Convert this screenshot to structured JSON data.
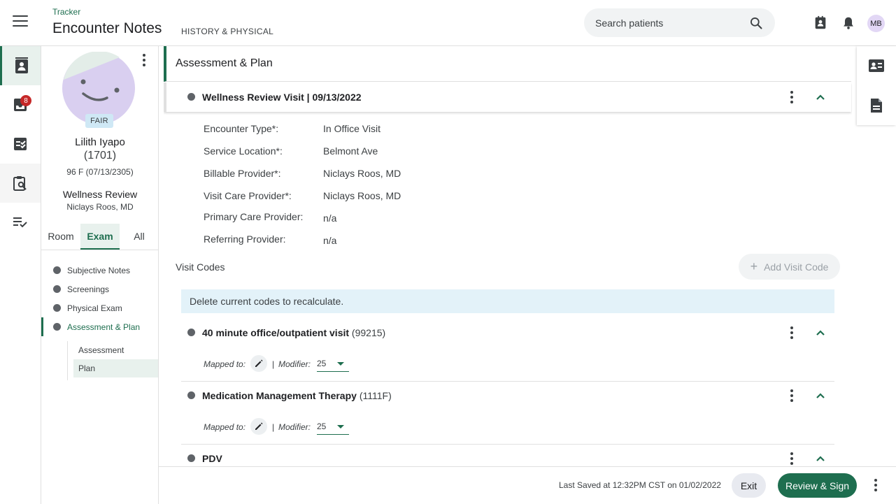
{
  "header": {
    "breadcrumb": "Tracker",
    "title": "Encounter Notes",
    "subtitle": "HISTORY & PHYSICAL",
    "search_placeholder": "Search patients",
    "user_initials": "MB"
  },
  "rail": {
    "items": [
      "patients-icon",
      "inbox-icon",
      "tasks-icon",
      "clipboard-search-icon",
      "checklist-icon"
    ],
    "inbox_badge": "8"
  },
  "patient": {
    "status": "FAIR",
    "name": "Lilith Iyapo",
    "id": "(1701)",
    "demographics": "96 F (07/13/2305)",
    "visit_type": "Wellness Review",
    "provider": "Niclays Roos, MD",
    "tabs": [
      "Room",
      "Exam",
      "All"
    ],
    "active_tab": "Exam",
    "sections": [
      "Subjective Notes",
      "Screenings",
      "Physical Exam",
      "Assessment & Plan"
    ],
    "subsections": [
      "Assessment",
      "Plan"
    ]
  },
  "main": {
    "section_title": "Assessment & Plan",
    "visit_title": "Wellness Review Visit | 09/13/2022",
    "details": [
      {
        "label": "Encounter Type*:",
        "value": "In Office Visit"
      },
      {
        "label": "Service Location*:",
        "value": "Belmont Ave"
      },
      {
        "label": "Billable Provider*:",
        "value": "Niclays Roos, MD"
      },
      {
        "label": "Visit Care Provider*:",
        "value": "Niclays Roos, MD"
      },
      {
        "label": "Primary Care Provider:",
        "value": "n/a"
      },
      {
        "label": "Referring Provider:",
        "value": "n/a"
      }
    ],
    "visit_codes_label": "Visit Codes",
    "add_code_label": "Add Visit Code",
    "info_message": "Delete current codes to recalculate.",
    "codes": [
      {
        "name": "40 minute office/outpatient visit",
        "code": "(99215)",
        "mapped_label": "Mapped to:",
        "pipe": "|",
        "modifier_label": "Modifier:",
        "modifier": "25"
      },
      {
        "name": "Medication Management Therapy",
        "code": "(1111F)",
        "mapped_label": "Mapped to:",
        "pipe": "|",
        "modifier_label": "Modifier:",
        "modifier": "25"
      },
      {
        "name": "PDV",
        "code": ""
      }
    ]
  },
  "footer": {
    "last_saved": "Last Saved at 12:32PM CST on 01/02/2022",
    "exit_label": "Exit",
    "sign_label": "Review & Sign"
  },
  "colors": {
    "brand": "#1e6e4f",
    "badge": "#c62828",
    "info_bg": "#e3f2f9"
  }
}
